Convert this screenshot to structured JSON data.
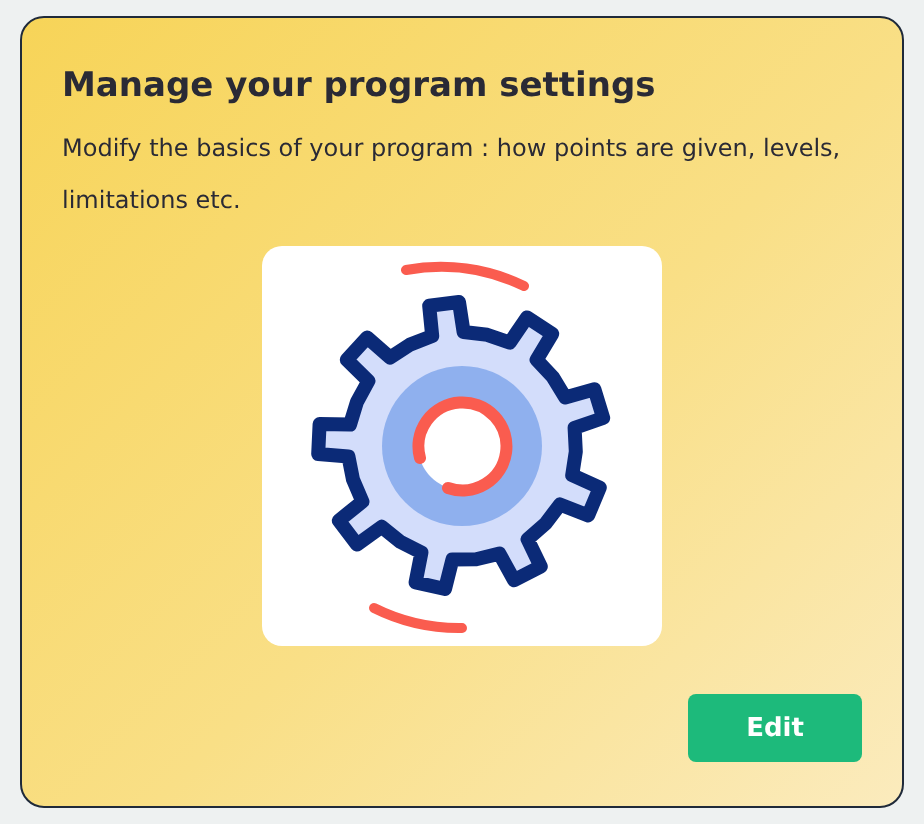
{
  "card": {
    "title": "Manage your program settings",
    "description": "Modify the basics of your program : how points are given, levels, limitations etc.",
    "button": "Edit"
  }
}
